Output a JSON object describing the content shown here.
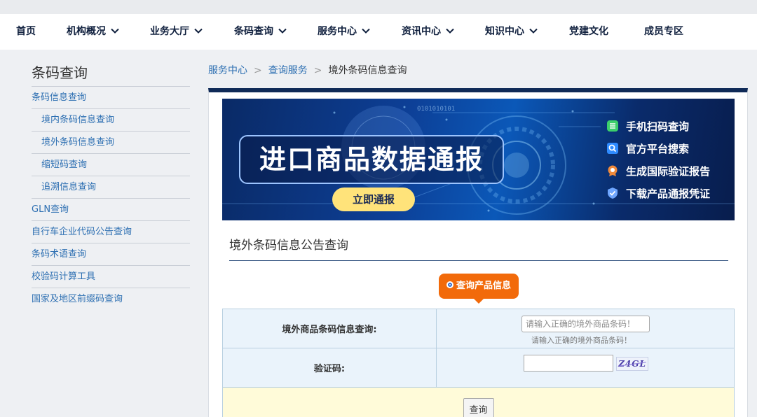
{
  "nav": {
    "items": [
      {
        "label": "首页",
        "dropdown": false
      },
      {
        "label": "机构概况",
        "dropdown": true
      },
      {
        "label": "业务大厅",
        "dropdown": true
      },
      {
        "label": "条码查询",
        "dropdown": true
      },
      {
        "label": "服务中心",
        "dropdown": true
      },
      {
        "label": "资讯中心",
        "dropdown": true
      },
      {
        "label": "知识中心",
        "dropdown": true
      },
      {
        "label": "党建文化",
        "dropdown": false
      },
      {
        "label": "成员专区",
        "dropdown": false
      }
    ]
  },
  "sidebar": {
    "title": "条码查询",
    "items": [
      {
        "label": "条码信息查询",
        "level": 1
      },
      {
        "label": "境内条码信息查询",
        "level": 2
      },
      {
        "label": "境外条码信息查询",
        "level": 2
      },
      {
        "label": "缩短码查询",
        "level": 2
      },
      {
        "label": "追溯信息查询",
        "level": 2
      },
      {
        "label": "GLN查询",
        "level": 1
      },
      {
        "label": "自行车企业代码公告查询",
        "level": 1
      },
      {
        "label": "条码术语查询",
        "level": 1
      },
      {
        "label": "校验码计算工具",
        "level": 1
      },
      {
        "label": "国家及地区前缀码查询",
        "level": 1
      }
    ]
  },
  "breadcrumb": {
    "items": [
      "服务中心",
      "查询服务",
      "境外条码信息查询"
    ],
    "separator": ">"
  },
  "banner": {
    "title": "进口商品数据通报",
    "button": "立即通报",
    "features": [
      {
        "label": "手机扫码查询",
        "icon": "scan-icon"
      },
      {
        "label": "官方平台搜索",
        "icon": "search-icon"
      },
      {
        "label": "生成国际验证报告",
        "icon": "badge-icon"
      },
      {
        "label": "下载产品通报凭证",
        "icon": "shield-check-icon"
      }
    ],
    "decor_digits": "0101010101"
  },
  "section": {
    "title": "境外条码信息公告查询"
  },
  "tab": {
    "label": "查询产品信息"
  },
  "form": {
    "barcode_label": "境外商品条码信息查询:",
    "barcode_placeholder": "请输入正确的境外商品条码！",
    "barcode_hint": "请输入正确的境外商品条码！",
    "captcha_label": "验证码:",
    "captcha_text": "Z4GL",
    "submit_label": "查询"
  },
  "colors": {
    "nav_text": "#0f1f3d",
    "link": "#2d6fb2",
    "accent_orange": "#f26a0a",
    "panel_top": "#0f2a57",
    "banner_button": "#ffe37a"
  }
}
